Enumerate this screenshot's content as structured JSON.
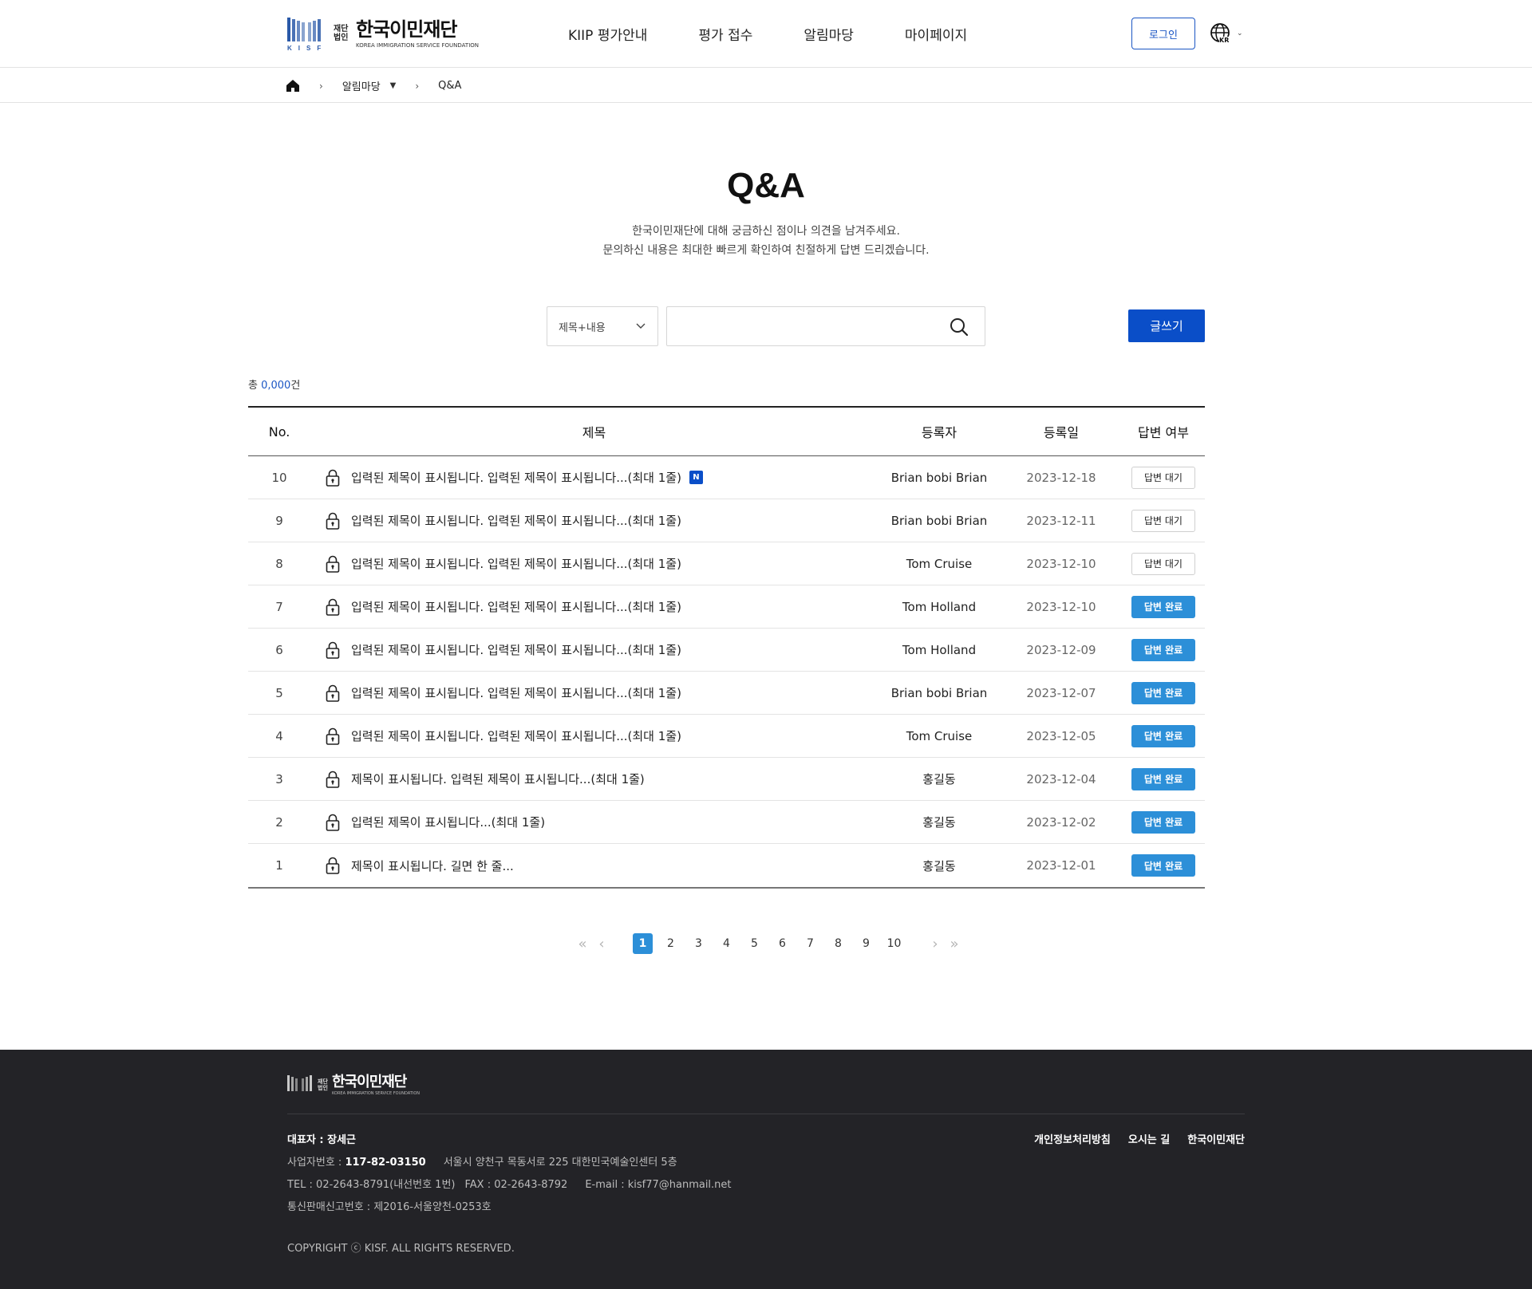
{
  "header": {
    "logo": {
      "small": "재단법인",
      "name": "한국이민재단",
      "sub": "KOREA IMMIGRATION SERVICE FOUNDATION",
      "mark": "KISF"
    },
    "nav": [
      "KIIP 평가안내",
      "평가 접수",
      "알림마당",
      "마이페이지"
    ],
    "login_label": "로그인",
    "lang_code": "KR",
    "lang_icon": "globe-icon"
  },
  "breadcrumb": {
    "home_icon": "home-icon",
    "section": "알림마당",
    "current": "Q&A"
  },
  "page": {
    "title": "Q&A",
    "desc_line1": "한국이민재단에 대해 궁금하신 점이나 의견을 남겨주세요.",
    "desc_line2": "문의하신 내용은 최대한 빠르게 확인하여 친절하게 답변 드리겠습니다."
  },
  "search": {
    "select_value": "제목+내용",
    "input_value": "",
    "write_label": "글쓰기"
  },
  "total": {
    "prefix": "총 ",
    "count": "0,000",
    "suffix": "건"
  },
  "table": {
    "headers": {
      "no": "No.",
      "title": "제목",
      "author": "등록자",
      "date": "등록일",
      "status": "답변 여부"
    },
    "rows": [
      {
        "no": "10",
        "title": "입력된 제목이 표시됩니다. 입력된 제목이 표시됩니다...(최대 1줄)",
        "is_new": true,
        "new_label": "N",
        "author": "Brian bobi Brian",
        "date": "2023-12-18",
        "status": "답변 대기",
        "status_type": "waiting"
      },
      {
        "no": "9",
        "title": "입력된 제목이 표시됩니다. 입력된 제목이 표시됩니다...(최대 1줄)",
        "is_new": false,
        "author": "Brian bobi Brian",
        "date": "2023-12-11",
        "status": "답변 대기",
        "status_type": "waiting"
      },
      {
        "no": "8",
        "title": "입력된 제목이 표시됩니다. 입력된 제목이 표시됩니다...(최대 1줄)",
        "is_new": false,
        "author": "Tom Cruise",
        "date": "2023-12-10",
        "status": "답변 대기",
        "status_type": "waiting"
      },
      {
        "no": "7",
        "title": "입력된 제목이 표시됩니다. 입력된 제목이 표시됩니다...(최대 1줄)",
        "is_new": false,
        "author": "Tom Holland",
        "date": "2023-12-10",
        "status": "답변 완료",
        "status_type": "done"
      },
      {
        "no": "6",
        "title": "입력된 제목이 표시됩니다. 입력된 제목이 표시됩니다...(최대 1줄)",
        "is_new": false,
        "author": "Tom Holland",
        "date": "2023-12-09",
        "status": "답변 완료",
        "status_type": "done"
      },
      {
        "no": "5",
        "title": "입력된 제목이 표시됩니다. 입력된 제목이 표시됩니다...(최대 1줄)",
        "is_new": false,
        "author": "Brian bobi Brian",
        "date": "2023-12-07",
        "status": "답변 완료",
        "status_type": "done"
      },
      {
        "no": "4",
        "title": "입력된 제목이 표시됩니다. 입력된 제목이 표시됩니다...(최대 1줄)",
        "is_new": false,
        "author": "Tom Cruise",
        "date": "2023-12-05",
        "status": "답변 완료",
        "status_type": "done"
      },
      {
        "no": "3",
        "title": "제목이 표시됩니다. 입력된 제목이 표시됩니다...(최대 1줄)",
        "is_new": false,
        "author": "홍길동",
        "date": "2023-12-04",
        "status": "답변 완료",
        "status_type": "done"
      },
      {
        "no": "2",
        "title": "입력된 제목이 표시됩니다...(최대 1줄)",
        "is_new": false,
        "author": "홍길동",
        "date": "2023-12-02",
        "status": "답변 완료",
        "status_type": "done"
      },
      {
        "no": "1",
        "title": "제목이 표시됩니다. 길면 한 줄...",
        "is_new": false,
        "author": "홍길동",
        "date": "2023-12-01",
        "status": "답변 완료",
        "status_type": "done"
      }
    ]
  },
  "pagination": {
    "first": "«",
    "prev": "‹",
    "next": "›",
    "last": "»",
    "pages": [
      "1",
      "2",
      "3",
      "4",
      "5",
      "6",
      "7",
      "8",
      "9",
      "10"
    ],
    "current": "1"
  },
  "footer": {
    "logo_small": "재단법인",
    "logo_name": "한국이민재단",
    "logo_sub": "KOREA IMMIGRATION SERVICE FOUNDATION",
    "ceo_label": "대표자 : ",
    "ceo": "장세근",
    "biz_label": "사업자번호 : ",
    "biz_no": "117-82-03150",
    "address": "서울시 양천구 목동서로 225 대한민국예술인센터 5층",
    "tel": "TEL : 02-2643-8791(내선번호 1번)",
    "fax": "FAX : 02-2643-8792",
    "email": "E-mail : kisf77@hanmail.net",
    "mail_order": "통신판매신고번호 : 제2016-서울양천-0253호",
    "links": [
      "개인정보처리방침",
      "오시는 길",
      "한국이민재단"
    ],
    "copyright": "COPYRIGHT ⓒ KISF. ALL RIGHTS RESERVED."
  },
  "colors": {
    "primary": "#0a4ec8",
    "done_badge": "#2c8fd8",
    "footer_bg": "#232327"
  }
}
